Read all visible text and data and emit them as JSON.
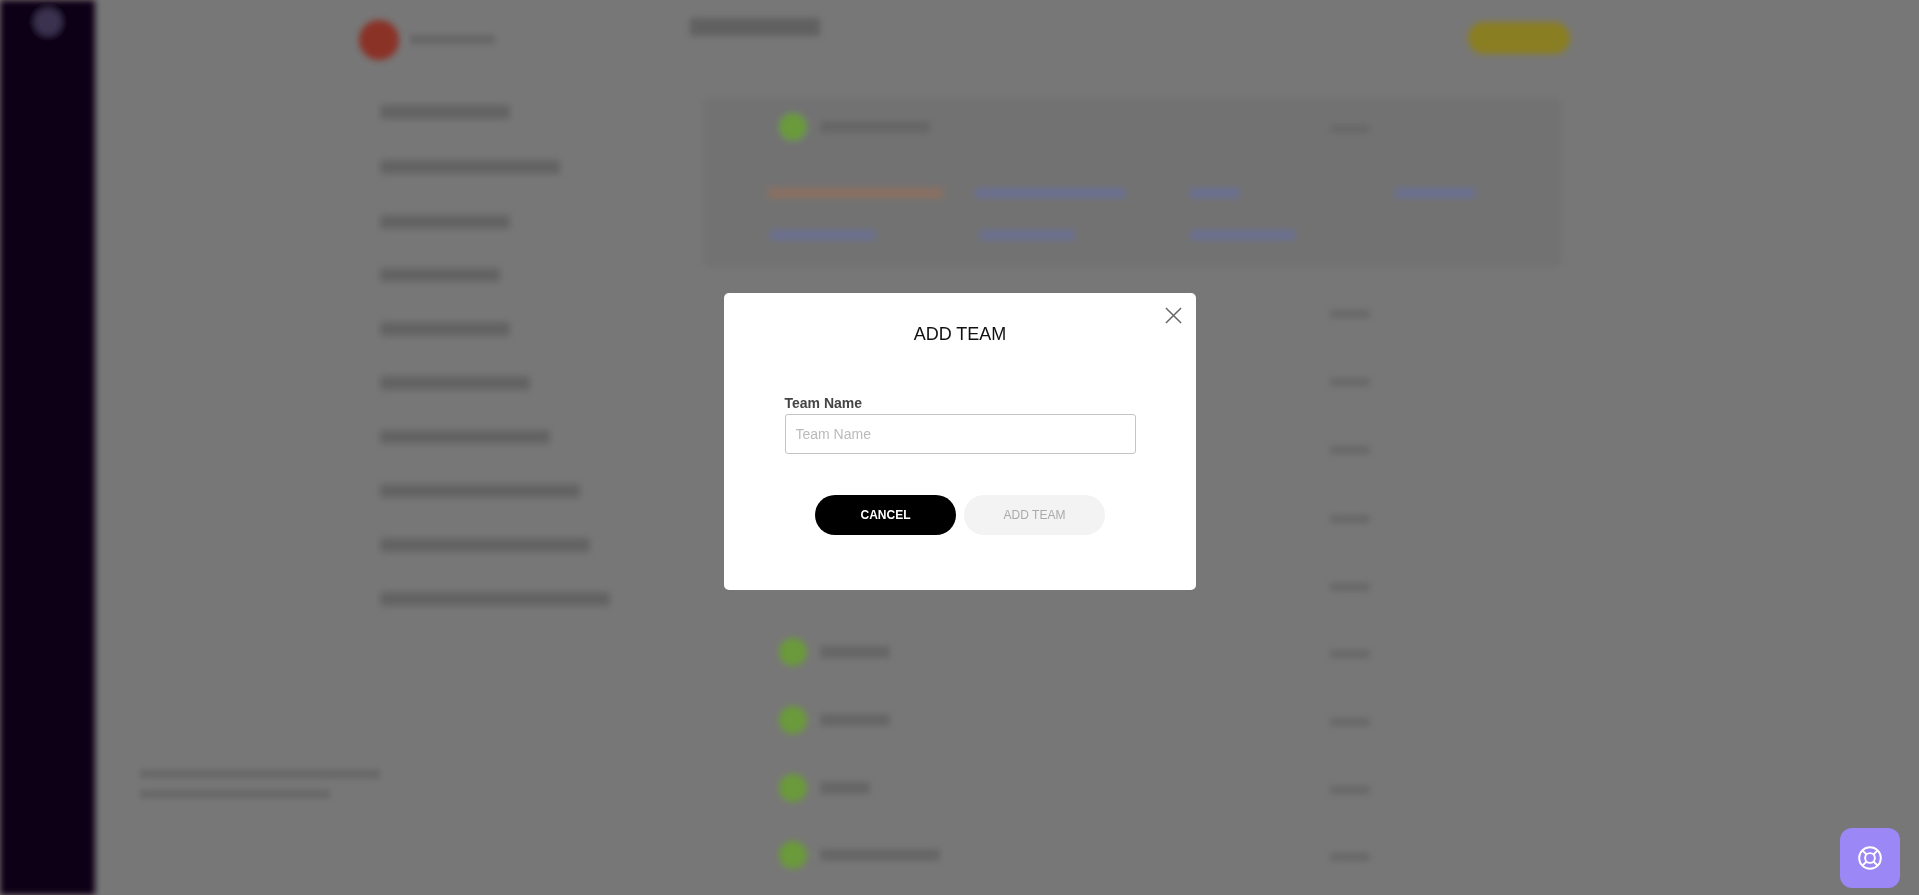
{
  "dialog": {
    "title": "ADD TEAM",
    "field": {
      "label": "Team Name",
      "placeholder": "Team Name"
    },
    "buttons": [
      {
        "label": "CANCEL",
        "disabled": false
      },
      {
        "label": "ADD TEAM",
        "disabled": true
      }
    ]
  }
}
